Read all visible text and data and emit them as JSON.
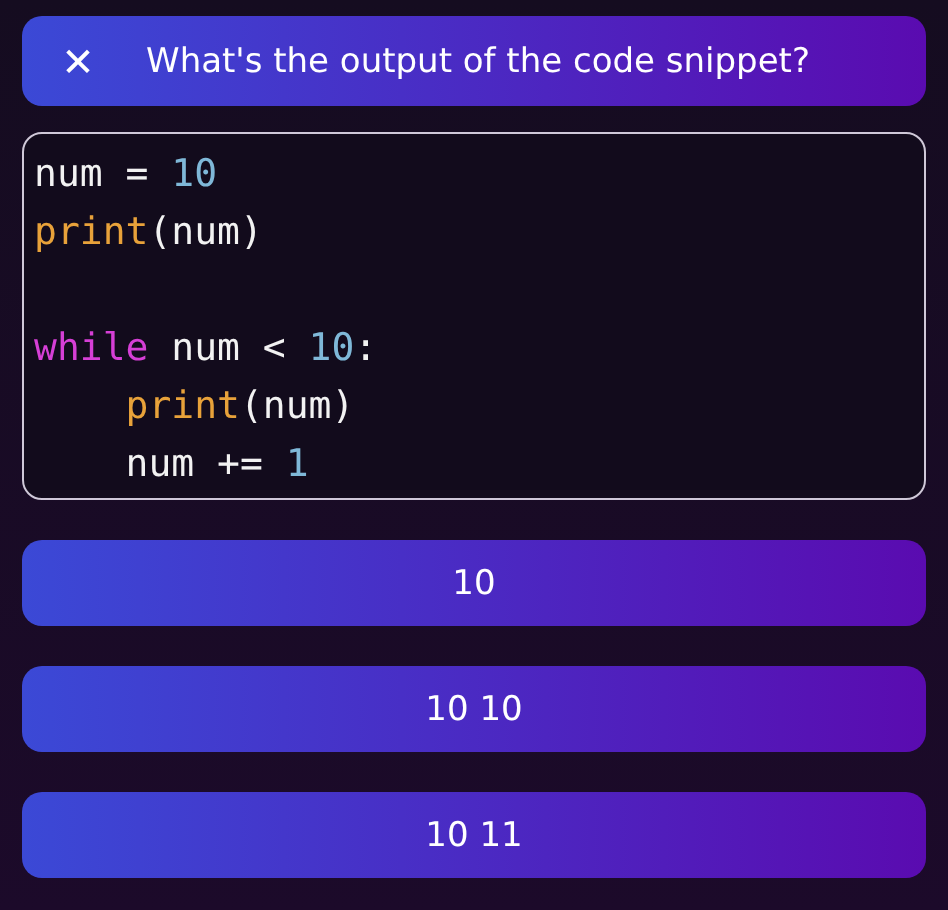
{
  "header": {
    "close_icon": "✕",
    "question": "What's the output of the code snippet?"
  },
  "code_lines": [
    {
      "kind": "code",
      "indented": false,
      "tokens": [
        {
          "kind": "plain",
          "text": "num = "
        },
        {
          "kind": "number",
          "text": "10"
        }
      ]
    },
    {
      "kind": "code",
      "indented": false,
      "tokens": [
        {
          "kind": "builtin",
          "text": "print"
        },
        {
          "kind": "plain",
          "text": "(num)"
        }
      ]
    },
    {
      "kind": "blank"
    },
    {
      "kind": "code",
      "indented": false,
      "tokens": [
        {
          "kind": "keyword",
          "text": "while"
        },
        {
          "kind": "plain",
          "text": " num < "
        },
        {
          "kind": "number",
          "text": "10"
        },
        {
          "kind": "plain",
          "text": ":"
        }
      ]
    },
    {
      "kind": "code",
      "indented": true,
      "tokens": [
        {
          "kind": "builtin",
          "text": "print"
        },
        {
          "kind": "plain",
          "text": "(num)"
        }
      ]
    },
    {
      "kind": "code",
      "indented": true,
      "tokens": [
        {
          "kind": "plain",
          "text": "num += "
        },
        {
          "kind": "number",
          "text": "1"
        }
      ]
    }
  ],
  "answers": [
    "10",
    "10 10",
    "10 11"
  ]
}
